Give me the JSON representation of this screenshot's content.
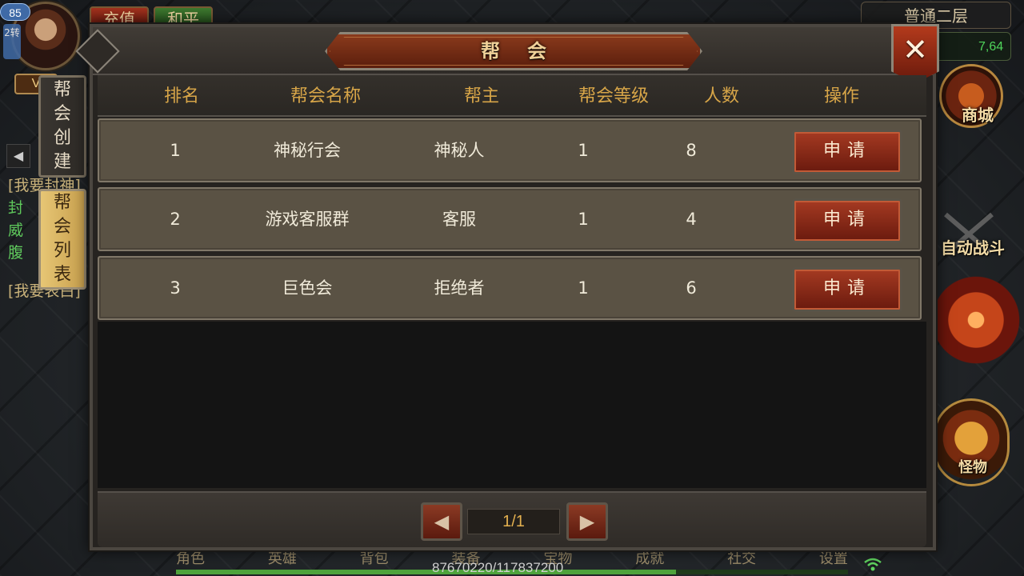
{
  "hud": {
    "level": "85",
    "level_sub": "2转",
    "vip": "V",
    "recharge_label": "充值",
    "peace_label": "和平",
    "map_name": "普通二层",
    "coords": "7,64",
    "shop_label": "商城",
    "auto_battle_label": "自动战斗",
    "monster_label": "怪物",
    "chat_lines": [
      "[我要封神]",
      "封",
      "威",
      "腹",
      "[我要表白]"
    ],
    "bottom_menu": [
      "角色",
      "英雄",
      "背包",
      "装备",
      "宝物",
      "成就",
      "社交",
      "设置"
    ],
    "exp_text": "87670220/117837200",
    "exp_fraction": 0.744,
    "wifi_icon": "wifi-icon"
  },
  "panel": {
    "title": "帮会",
    "close_label": "✕",
    "tabs": [
      {
        "label": [
          "帮",
          "会",
          "创",
          "建"
        ],
        "active": false
      },
      {
        "label": [
          "帮",
          "会",
          "列",
          "表"
        ],
        "active": true
      }
    ],
    "columns": [
      "排名",
      "帮会名称",
      "帮主",
      "帮会等级",
      "人数",
      "操作"
    ],
    "rows": [
      {
        "rank": "1",
        "name": "神秘行会",
        "leader": "神秘人",
        "level": "1",
        "members": "8",
        "action": "申请"
      },
      {
        "rank": "2",
        "name": "游戏客服群",
        "leader": "客服",
        "level": "1",
        "members": "4",
        "action": "申请"
      },
      {
        "rank": "3",
        "name": "巨色会",
        "leader": "拒绝者",
        "level": "1",
        "members": "6",
        "action": "申请"
      }
    ],
    "pagination": {
      "page": "1/1",
      "prev_icon": "◀",
      "next_icon": "▶"
    }
  },
  "colors": {
    "accent_gold": "#d7a548",
    "button_red": "#a53a22",
    "row_bg": "#5a5244",
    "active_tab": "#e7c675"
  }
}
